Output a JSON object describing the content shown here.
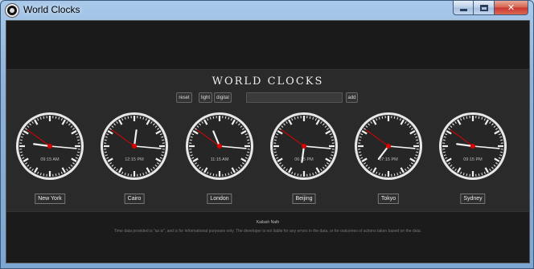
{
  "window": {
    "title": "World Clocks"
  },
  "page": {
    "title": "WORLD CLOCKS"
  },
  "controls": {
    "reset_label": "reset",
    "light_label": "light",
    "digital_label": "digital",
    "search_value": "",
    "add_label": "add"
  },
  "clocks": [
    {
      "city": "New York",
      "time": "09:15 AM",
      "hour": 9,
      "minute": 15,
      "second": 51
    },
    {
      "city": "Cairo",
      "time": "12:15 PM",
      "hour": 12,
      "minute": 15,
      "second": 51
    },
    {
      "city": "London",
      "time": "11:15 AM",
      "hour": 11,
      "minute": 15,
      "second": 51
    },
    {
      "city": "Beijing",
      "time": "06:15 PM",
      "hour": 6,
      "minute": 15,
      "second": 51
    },
    {
      "city": "Tokyo",
      "time": "07:15 PM",
      "hour": 7,
      "minute": 15,
      "second": 51
    },
    {
      "city": "Sydney",
      "time": "09:15 PM",
      "hour": 9,
      "minute": 15,
      "second": 51
    }
  ],
  "footer": {
    "name": "Kailash Nath",
    "disclaimer": "Time data provided is \"as is\", and is for informational purposes only. The developer is not liable for any errors in the data, or for outcomes of actions taken based on the data."
  },
  "colors": {
    "accent": "#dd0000",
    "background": "#1b1b1b",
    "band": "#2a2a2a"
  },
  "icons": [
    "app-clock-icon",
    "minimize-icon",
    "maximize-icon",
    "close-icon"
  ]
}
